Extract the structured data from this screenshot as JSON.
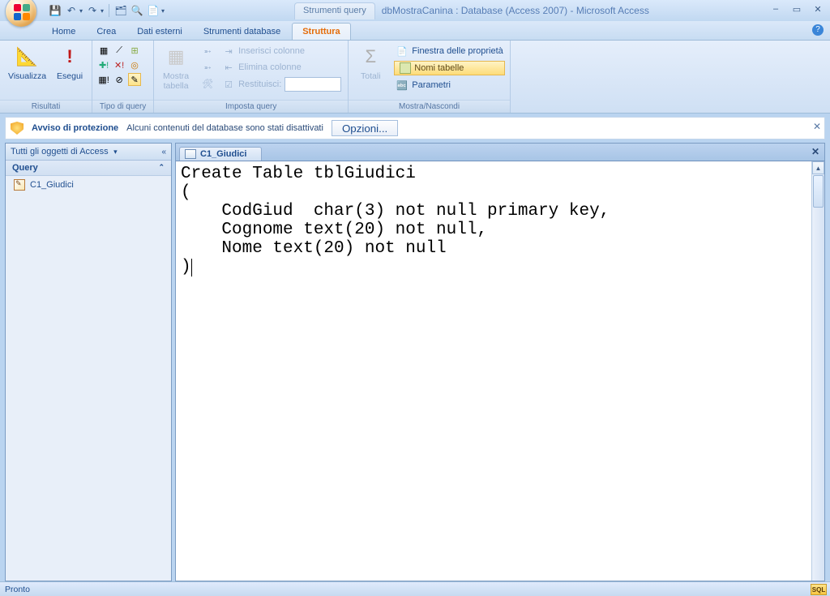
{
  "title": {
    "context_tab": "Strumenti query",
    "document": "dbMostraCanina : Database (Access 2007) - Microsoft Access"
  },
  "qat": {
    "save": "💾",
    "undo": "↶",
    "redo": "↷"
  },
  "tabs": {
    "home": "Home",
    "create": "Crea",
    "external": "Dati esterni",
    "dbtools": "Strumenti database",
    "structure": "Struttura"
  },
  "ribbon": {
    "results": {
      "view": "Visualizza",
      "run": "Esegui",
      "label": "Risultati"
    },
    "qtype_label": "Tipo di query",
    "setup": {
      "showtable": "Mostra\ntabella",
      "insertcols": "Inserisci colonne",
      "deletecols": "Elimina colonne",
      "return_lbl": "Restituisci:",
      "label": "Imposta query"
    },
    "showhide": {
      "totals": "Totali",
      "propsheet": "Finestra delle proprietà",
      "tablenames": "Nomi tabelle",
      "params": "Parametri",
      "label": "Mostra/Nascondi"
    }
  },
  "security": {
    "heading": "Avviso di protezione",
    "message": "Alcuni contenuti del database sono stati disattivati",
    "options": "Opzioni..."
  },
  "navpane": {
    "header": "Tutti gli oggetti di Access",
    "group": "Query",
    "item1": "C1_Giudici"
  },
  "doc": {
    "tab_name": "C1_Giudici",
    "sql": "Create Table tblGiudici\n(\n    CodGiud  char(3) not null primary key,\n    Cognome text(20) not null,\n    Nome text(20) not null\n)"
  },
  "status": {
    "ready": "Pronto",
    "sql": "SQL"
  }
}
